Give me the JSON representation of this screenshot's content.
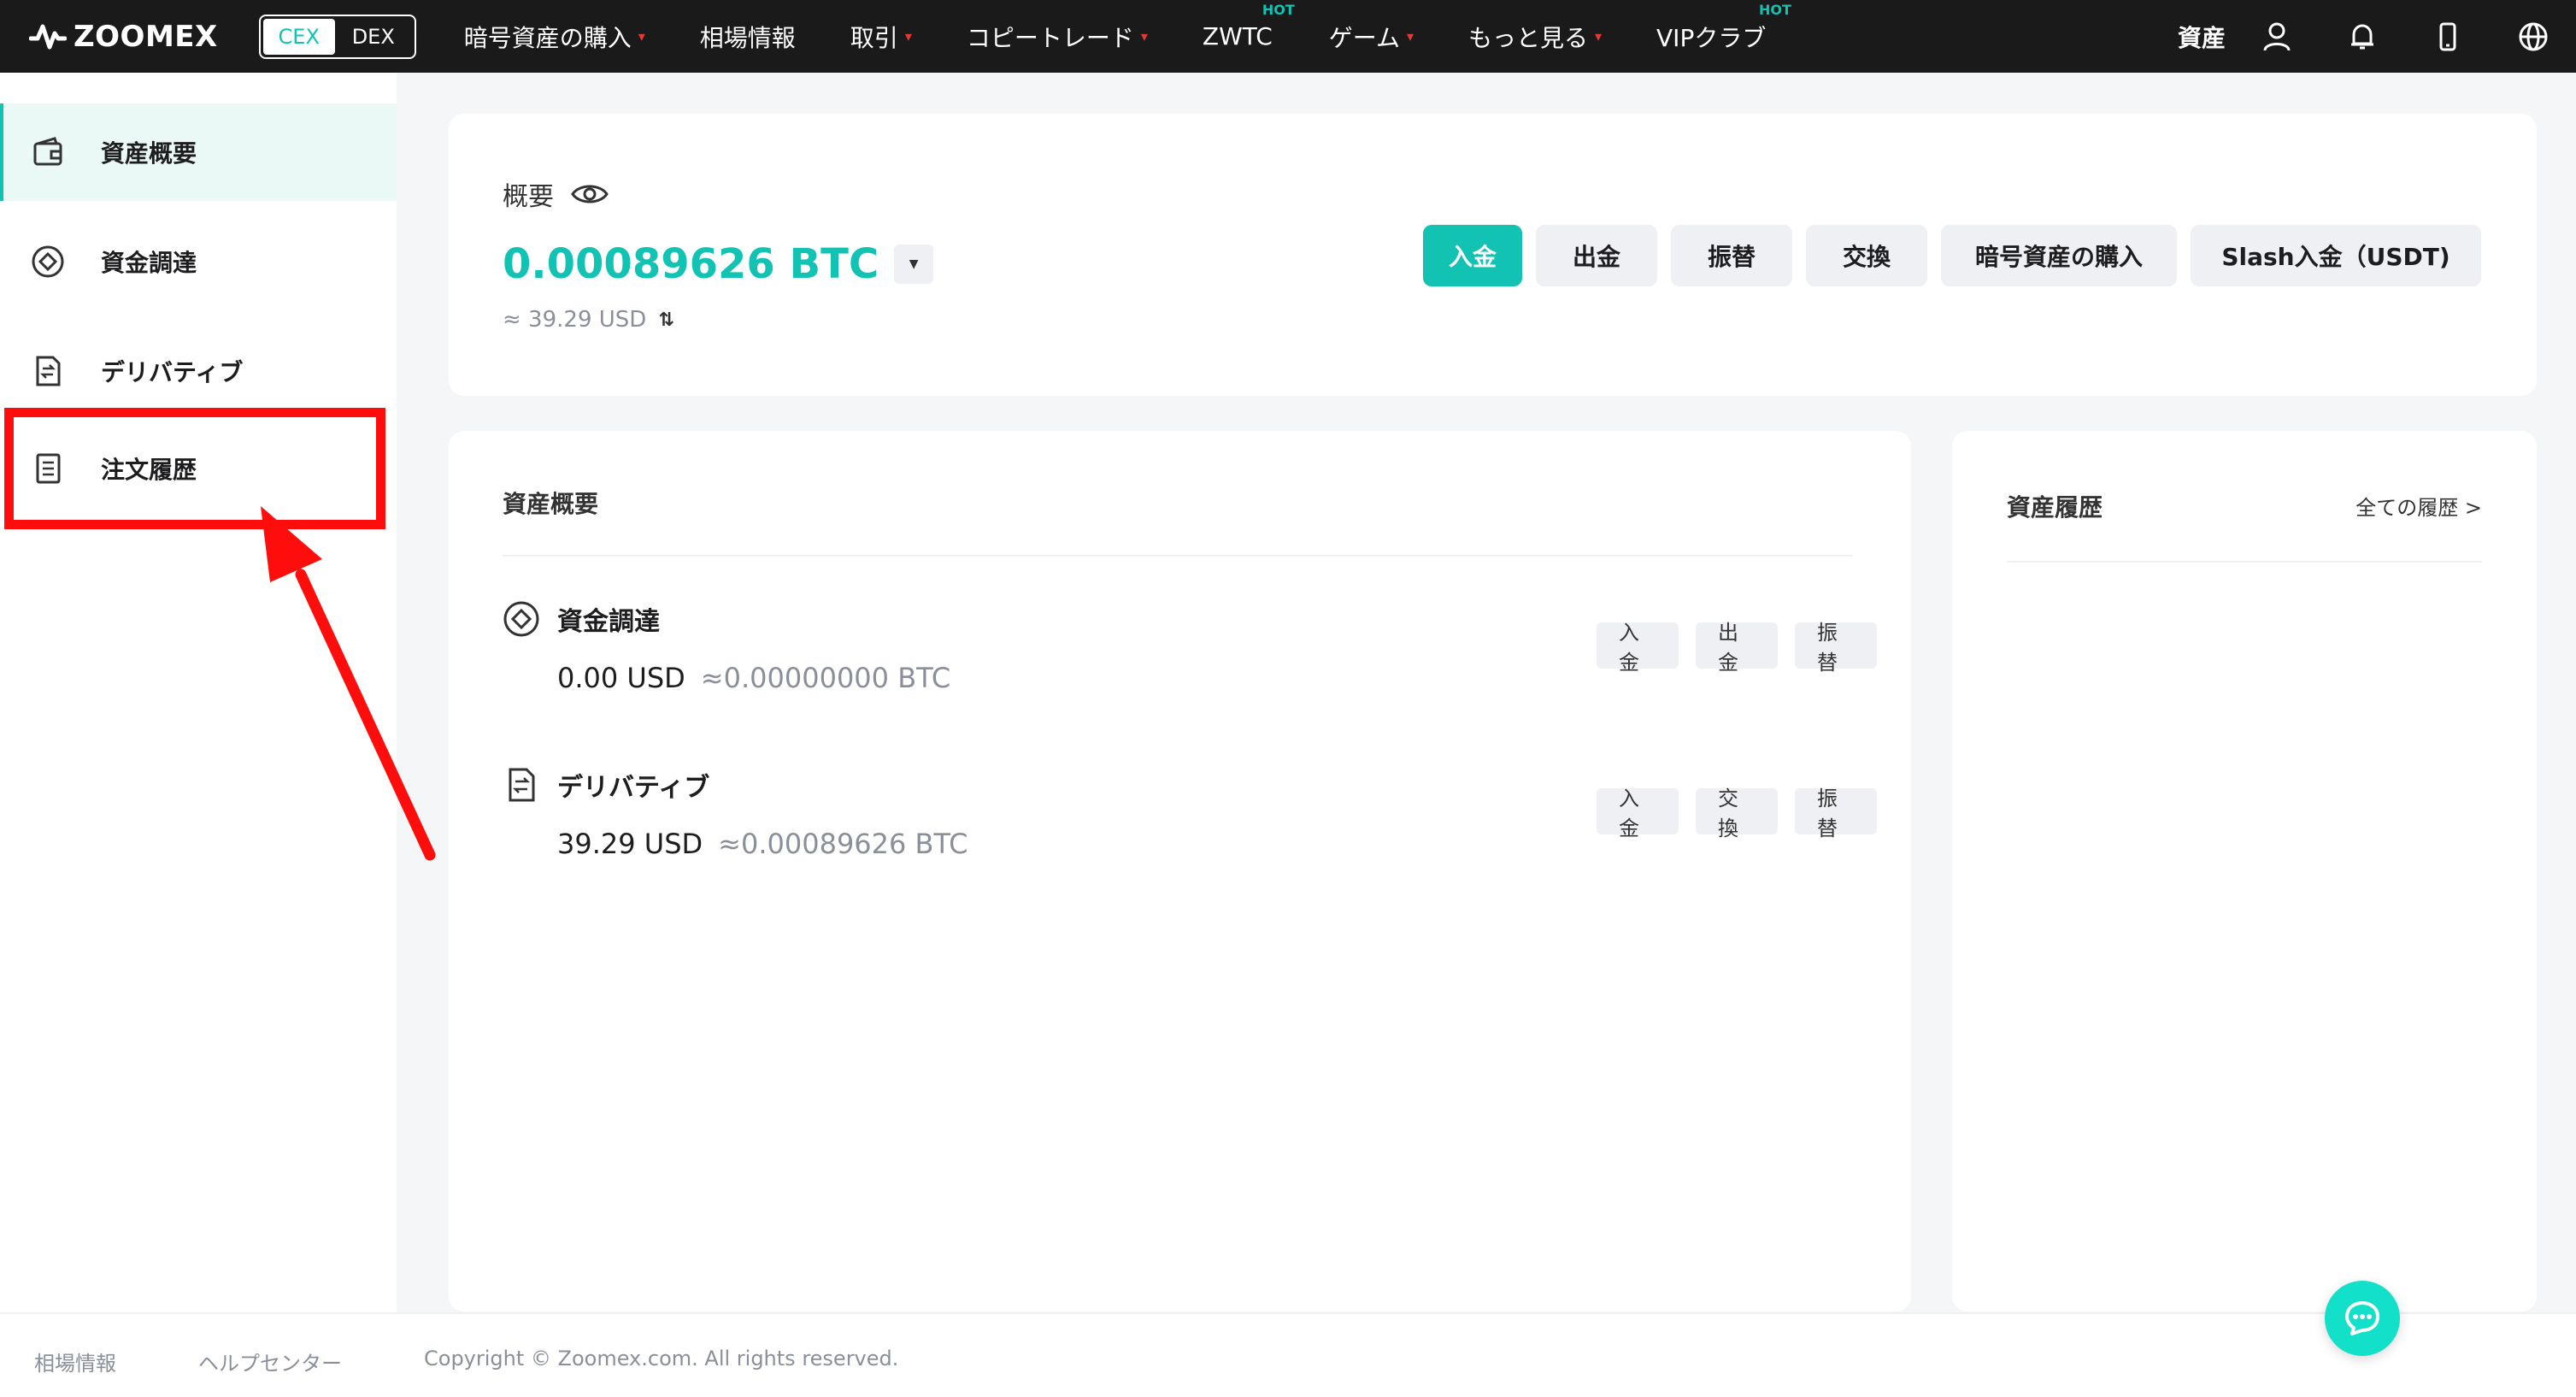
{
  "nav": {
    "logo_text": "ZOOMEX",
    "cex_label": "CEX",
    "dex_label": "DEX",
    "items": [
      {
        "label": "暗号資産の購入",
        "caret": "▾",
        "hot": ""
      },
      {
        "label": "相場情報",
        "caret": "",
        "hot": ""
      },
      {
        "label": "取引",
        "caret": "▾",
        "hot": ""
      },
      {
        "label": "コピートレード",
        "caret": "▾",
        "hot": ""
      },
      {
        "label": "ZWTC",
        "caret": "",
        "hot": "HOT"
      },
      {
        "label": "ゲーム",
        "caret": "▾",
        "hot": ""
      },
      {
        "label": "もっと見る",
        "caret": "▾",
        "hot": ""
      },
      {
        "label": "VIPクラブ",
        "caret": "",
        "hot": "HOT"
      }
    ],
    "assets_label": "資産",
    "icons": [
      "user-icon",
      "bell-icon",
      "phone-icon",
      "globe-icon"
    ]
  },
  "sidebar": {
    "items": [
      {
        "label": "資産概要",
        "icon": "wallet-icon",
        "active": true
      },
      {
        "label": "資金調達",
        "icon": "diamond-icon",
        "active": false
      },
      {
        "label": "デリバティブ",
        "icon": "derivatives-icon",
        "active": false
      },
      {
        "label": "注文履歴",
        "icon": "document-icon",
        "active": false
      }
    ]
  },
  "summary": {
    "title": "概要",
    "btc_value": "0.00089626 BTC",
    "usd_value": "≈ 39.29 USD",
    "swap_glyph": "⇅",
    "buttons": [
      "入金",
      "出金",
      "振替",
      "交換",
      "暗号資産の購入",
      "Slash入金（USDT)"
    ]
  },
  "assets": {
    "title": "資産概要",
    "rows": [
      {
        "name": "資金調達",
        "usd": "0.00 USD",
        "btc": "≈0.00000000 BTC",
        "buttons": [
          "入金",
          "出金",
          "振替"
        ]
      },
      {
        "name": "デリバティブ",
        "usd": "39.29 USD",
        "btc": "≈0.00089626 BTC",
        "buttons": [
          "入金",
          "交換",
          "振替"
        ]
      }
    ]
  },
  "history": {
    "title": "資産履歴",
    "link": "全ての履歴 >"
  },
  "footer": {
    "market": "相場情報",
    "help": "ヘルプセンター",
    "copyright": "Copyright © Zoomex.com. All rights reserved."
  },
  "colors": {
    "accent": "#12c2b2",
    "nav_bg": "#1a1a1a",
    "highlight": "#ff0d0d",
    "caret": "#e53935"
  }
}
